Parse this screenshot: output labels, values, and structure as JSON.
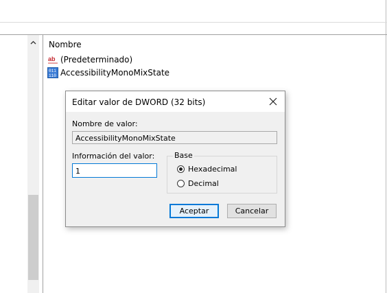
{
  "values_pane": {
    "column_name": "Nombre",
    "rows": [
      {
        "icon": "string-value-icon",
        "name": "(Predeterminado)"
      },
      {
        "icon": "binary-value-icon",
        "name": "AccessibilityMonoMixState"
      }
    ]
  },
  "dialog": {
    "title": "Editar valor de DWORD (32 bits)",
    "name_label": "Nombre de valor:",
    "name_value": "AccessibilityMonoMixState",
    "data_label": "Información del valor:",
    "data_value": "1",
    "base_label": "Base",
    "base_options": [
      {
        "label": "Hexadecimal",
        "selected": true
      },
      {
        "label": "Decimal",
        "selected": false
      }
    ],
    "ok_label": "Aceptar",
    "cancel_label": "Cancelar"
  }
}
